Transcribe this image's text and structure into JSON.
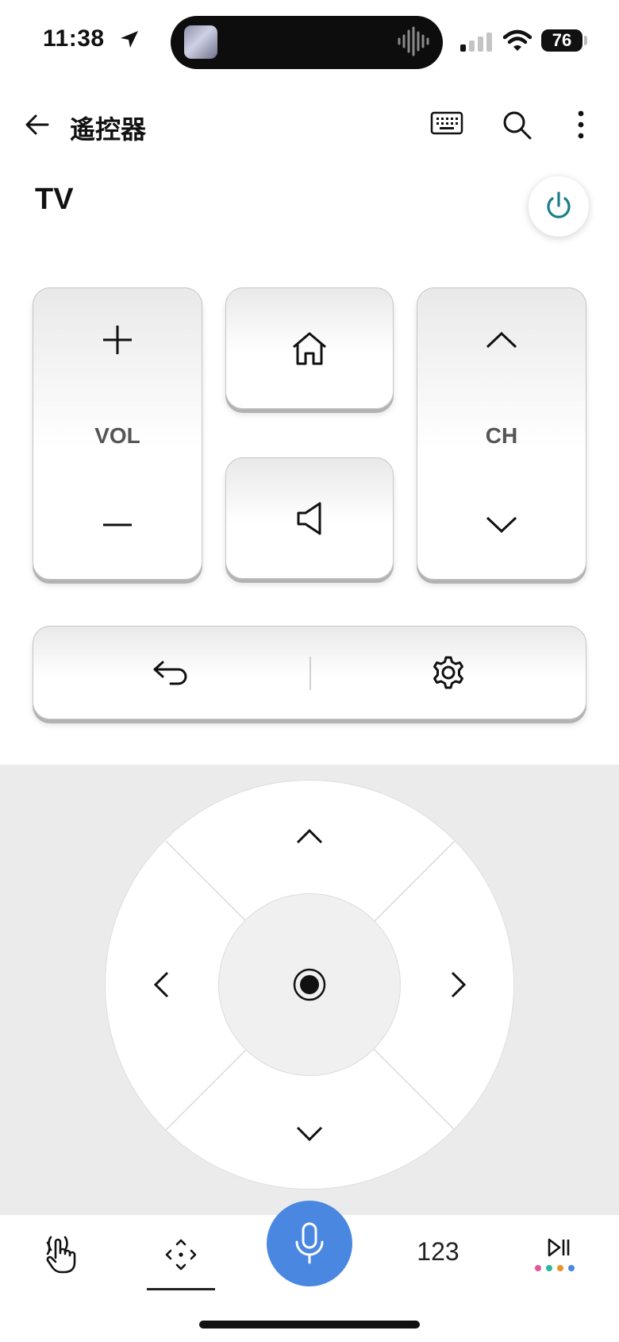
{
  "status_bar": {
    "time": "11:38",
    "battery": "76"
  },
  "app_bar": {
    "title": "遙控器"
  },
  "device": {
    "name": "TV"
  },
  "keys": {
    "volume_label": "VOL",
    "channel_label": "CH"
  },
  "bottom_bar": {
    "numpad_label": "123"
  },
  "colors": {
    "accent": "#4a87e0",
    "power_icon": "#1b7d8c",
    "dpad_background": "#ebebeb"
  },
  "icons": {
    "back": "arrow-left-icon",
    "keyboard": "keyboard-icon",
    "search": "search-icon",
    "more": "more-vert-icon",
    "power": "power-icon",
    "home": "home-icon",
    "mute": "speaker-icon",
    "return": "return-icon",
    "settings": "gear-icon",
    "touch": "touch-remote-icon",
    "dpad": "dpad-icon",
    "mic": "mic-icon",
    "media": "play-pause-icon"
  }
}
